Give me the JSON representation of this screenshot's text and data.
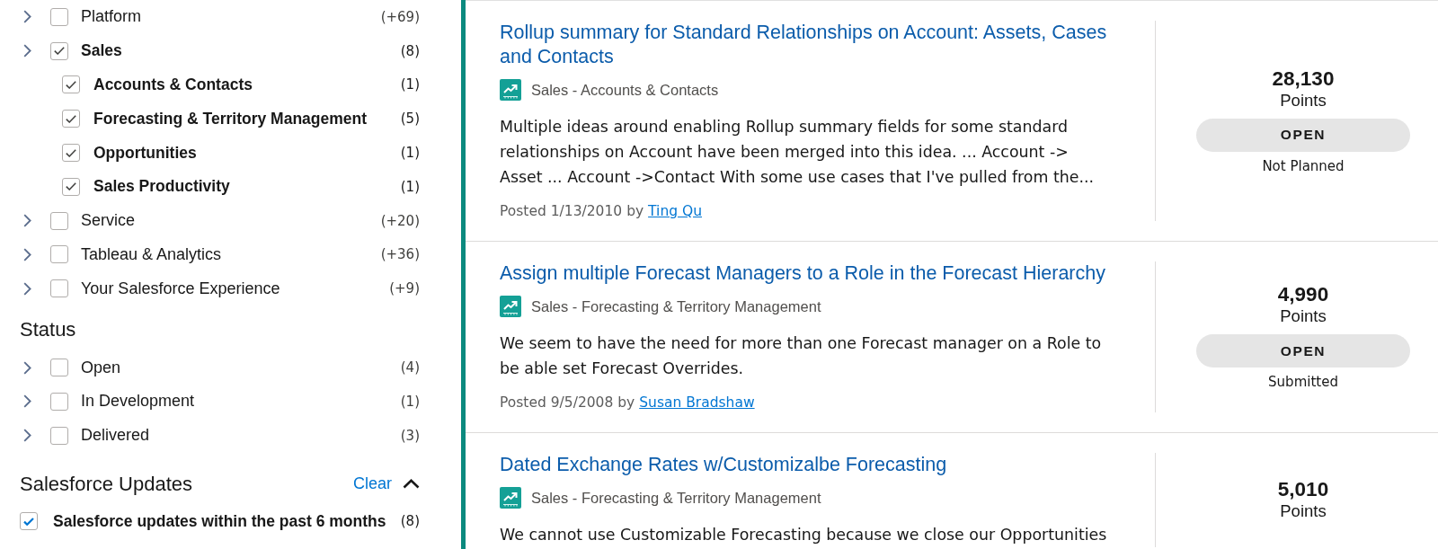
{
  "sidebar": {
    "categories": [
      {
        "label": "Platform",
        "count": "(+69)",
        "checked": false
      },
      {
        "label": "Sales",
        "count": "(8)",
        "checked": true,
        "children": [
          {
            "label": "Accounts & Contacts",
            "count": "(1)",
            "checked": true
          },
          {
            "label": "Forecasting & Territory Management",
            "count": "(5)",
            "checked": true
          },
          {
            "label": "Opportunities",
            "count": "(1)",
            "checked": true
          },
          {
            "label": "Sales Productivity",
            "count": "(1)",
            "checked": true
          }
        ]
      },
      {
        "label": "Service",
        "count": "(+20)",
        "checked": false
      },
      {
        "label": "Tableau & Analytics",
        "count": "(+36)",
        "checked": false
      },
      {
        "label": "Your Salesforce Experience",
        "count": "(+9)",
        "checked": false
      }
    ],
    "status": {
      "heading": "Status",
      "items": [
        {
          "label": "Open",
          "count": "(4)",
          "checked": false
        },
        {
          "label": "In Development",
          "count": "(1)",
          "checked": false
        },
        {
          "label": "Delivered",
          "count": "(3)",
          "checked": false
        }
      ]
    },
    "updates": {
      "heading": "Salesforce Updates",
      "clear": "Clear",
      "expanded": true,
      "items": [
        {
          "label": "Salesforce updates within the past 6 months",
          "count": "(8)",
          "checked": true
        }
      ]
    }
  },
  "ideas": [
    {
      "title": "Rollup summary for Standard Relationships on Account: Assets, Cases and Contacts",
      "category": "Sales - Accounts & Contacts",
      "description": "Multiple ideas around enabling Rollup summary fields for some standard relationships on Account have been merged into this idea. ... Account -> Asset ... Account ->Contact With some use cases that I've pulled from the...",
      "posted": "Posted 1/13/2010 by",
      "author": "Ting Qu",
      "points": "28,130",
      "points_label": "Points",
      "status": "OPEN",
      "status_detail": "Not Planned"
    },
    {
      "title": "Assign multiple Forecast Managers to a Role in the Forecast Hierarchy",
      "category": "Sales - Forecasting & Territory Management",
      "description": "We seem to have the need for more than one Forecast manager on a Role to be able set Forecast Overrides.",
      "posted": "Posted 9/5/2008 by",
      "author": "Susan Bradshaw",
      "points": "4,990",
      "points_label": "Points",
      "status": "OPEN",
      "status_detail": "Submitted"
    },
    {
      "title": "Dated Exchange Rates w/Customizalbe Forecasting",
      "category": "Sales - Forecasting & Territory Management",
      "description": "We cannot use Customizable Forecasting because we close our Opportunities",
      "points": "5,010",
      "points_label": "Points"
    }
  ]
}
